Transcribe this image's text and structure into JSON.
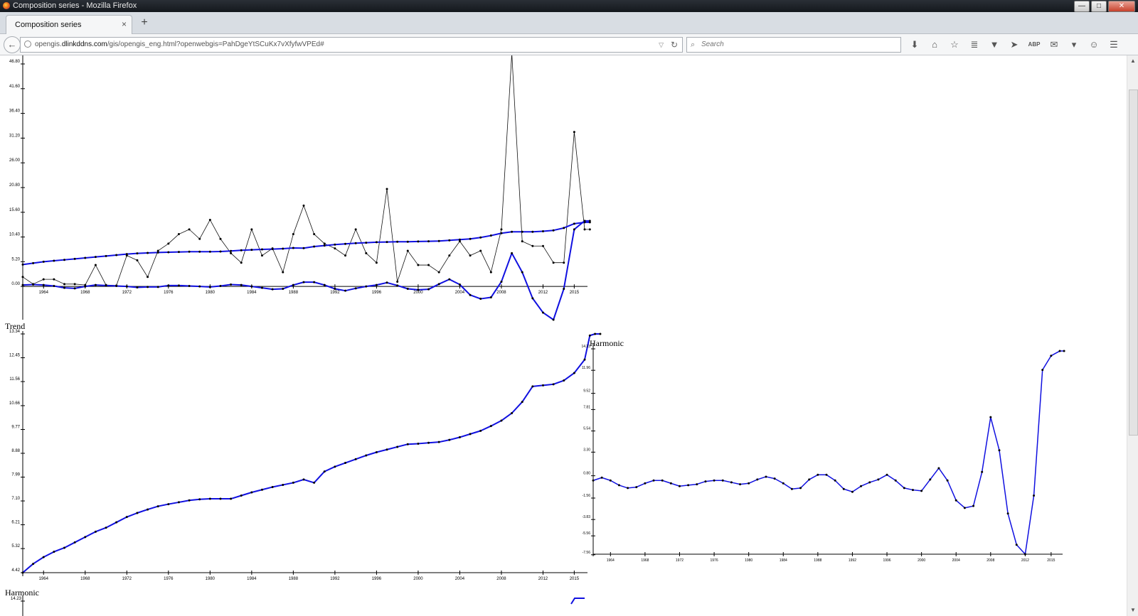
{
  "window": {
    "title": "Composition series - Mozilla Firefox",
    "controls": [
      "—",
      "□",
      "✕"
    ]
  },
  "tab": {
    "label": "Composition series",
    "close": "×",
    "new_tab": "+"
  },
  "navbar": {
    "back": "←",
    "url_prefix": "opengis.",
    "url_domain": "dlinkddns.com",
    "url_suffix": "/gis/opengis_eng.html?openwebgis=PahDgeYtSCuKx7vXfyfwVPEd#",
    "search_placeholder": "Search",
    "dropdown": "▽",
    "reload": "↻",
    "search_icon": "⌕",
    "toolbar_icons": [
      "⬇",
      "⌂",
      "☆",
      "≣",
      "▼",
      "➤",
      "ABP",
      "✉",
      "▾",
      "☺",
      "☰"
    ]
  },
  "scrollbar": {
    "up": "▲",
    "down": "▼"
  },
  "colors": {
    "blue": "#1010e0",
    "black": "#111111"
  },
  "charts": [
    {
      "id": "composition",
      "title": "",
      "chart_data": {
        "type": "line",
        "x": [
          1962,
          1963,
          1964,
          1965,
          1966,
          1967,
          1968,
          1969,
          1970,
          1971,
          1972,
          1973,
          1974,
          1975,
          1976,
          1977,
          1978,
          1979,
          1980,
          1981,
          1982,
          1983,
          1984,
          1985,
          1986,
          1987,
          1988,
          1989,
          1990,
          1991,
          1992,
          1993,
          1994,
          1995,
          1996,
          1997,
          1998,
          1999,
          2000,
          2001,
          2002,
          2003,
          2004,
          2005,
          2006,
          2007,
          2008,
          2009,
          2010,
          2011,
          2012,
          2013,
          2014,
          2015,
          2016
        ],
        "ylim": [
          -7.0,
          46.8
        ],
        "yticks": [
          "0.00",
          "5.20",
          "10.40",
          "15.60",
          "20.80",
          "26.00",
          "31.20",
          "36.40",
          "41.60",
          "46.80"
        ],
        "xticks": [
          "1964",
          "1968",
          "1972",
          "1976",
          "1980",
          "1984",
          "1988",
          "1992",
          "1996",
          "2000",
          "2004",
          "2008",
          "2012",
          "2015"
        ],
        "series": [
          {
            "name": "",
            "color": "#111111",
            "width": 0.8,
            "values": [
              2.0,
              0.5,
              1.5,
              1.5,
              0.5,
              0.5,
              0.3,
              4.5,
              0.3,
              0.2,
              6.5,
              5.5,
              2.0,
              7.5,
              9.0,
              11.0,
              12.0,
              10.0,
              14.0,
              10.0,
              7.0,
              5.0,
              12.0,
              6.5,
              8.0,
              3.0,
              11.0,
              17.0,
              11.0,
              9.0,
              8.0,
              6.5,
              12.0,
              7.0,
              5.0,
              20.5,
              1.0,
              7.5,
              4.5,
              4.5,
              3.0,
              6.5,
              9.5,
              6.5,
              7.5,
              3.0,
              12.0,
              49.0,
              9.5,
              8.5,
              8.5,
              5.0,
              5.0,
              32.5,
              12.0,
              12.0
            ]
          },
          {
            "name": "",
            "color": "#1010e0",
            "width": 2,
            "values": [
              4.6,
              4.9,
              5.2,
              5.4,
              5.6,
              5.8,
              6.0,
              6.2,
              6.4,
              6.6,
              6.8,
              6.95,
              7.05,
              7.15,
              7.2,
              7.25,
              7.3,
              7.3,
              7.3,
              7.35,
              7.45,
              7.6,
              7.7,
              7.8,
              7.85,
              7.95,
              8.1,
              8.05,
              8.4,
              8.6,
              8.8,
              8.95,
              9.1,
              9.2,
              9.3,
              9.35,
              9.4,
              9.4,
              9.45,
              9.5,
              9.55,
              9.7,
              9.85,
              10.0,
              10.3,
              10.7,
              11.2,
              11.5,
              11.5,
              11.5,
              11.6,
              11.8,
              12.3,
              13.2,
              13.5,
              13.5
            ]
          },
          {
            "name": "",
            "color": "#1010e0",
            "width": 2,
            "values": [
              0.3,
              0.4,
              0.3,
              0.1,
              -0.3,
              -0.4,
              0.0,
              0.3,
              0.2,
              0.1,
              0.0,
              -0.2,
              -0.1,
              -0.1,
              0.2,
              0.2,
              0.1,
              0.0,
              -0.1,
              0.1,
              0.4,
              0.3,
              0.0,
              -0.3,
              -0.6,
              -0.5,
              0.3,
              0.9,
              0.9,
              0.3,
              -0.5,
              -0.9,
              -0.4,
              0.0,
              0.3,
              0.8,
              0.2,
              -0.5,
              -0.7,
              -0.6,
              0.5,
              1.5,
              0.4,
              -1.8,
              -2.6,
              -2.3,
              1.0,
              7.0,
              3.0,
              -2.5,
              -5.5,
              -7.0,
              -0.5,
              12.0,
              13.8,
              13.8
            ]
          }
        ]
      }
    },
    {
      "id": "trend",
      "title": "Trend",
      "chart_data": {
        "type": "line",
        "x": [
          1962,
          1963,
          1964,
          1965,
          1966,
          1967,
          1968,
          1969,
          1970,
          1971,
          1972,
          1973,
          1974,
          1975,
          1976,
          1977,
          1978,
          1979,
          1980,
          1981,
          1982,
          1983,
          1984,
          1985,
          1986,
          1987,
          1988,
          1989,
          1990,
          1991,
          1992,
          1993,
          1994,
          1995,
          1996,
          1997,
          1998,
          1999,
          2000,
          2001,
          2002,
          2003,
          2004,
          2005,
          2006,
          2007,
          2008,
          2009,
          2010,
          2011,
          2012,
          2013,
          2014,
          2015,
          2016
        ],
        "ylim": [
          4.42,
          13.34
        ],
        "yticks": [
          "4.42",
          "5.32",
          "6.21",
          "7.10",
          "7.99",
          "8.88",
          "9.77",
          "10.66",
          "11.56",
          "12.45",
          "13.34"
        ],
        "xticks": [
          "1964",
          "1968",
          "1972",
          "1976",
          "1980",
          "1984",
          "1988",
          "1992",
          "1996",
          "2000",
          "2004",
          "2008",
          "2012",
          "2015"
        ],
        "series": [
          {
            "name": "",
            "color": "#1010e0",
            "width": 2,
            "values": [
              4.42,
              4.75,
              5.0,
              5.2,
              5.35,
              5.55,
              5.75,
              5.95,
              6.1,
              6.3,
              6.5,
              6.65,
              6.78,
              6.9,
              6.98,
              7.05,
              7.12,
              7.16,
              7.18,
              7.18,
              7.18,
              7.3,
              7.42,
              7.52,
              7.62,
              7.7,
              7.78,
              7.9,
              7.78,
              8.2,
              8.38,
              8.52,
              8.66,
              8.8,
              8.92,
              9.02,
              9.12,
              9.22,
              9.24,
              9.27,
              9.3,
              9.38,
              9.48,
              9.6,
              9.72,
              9.9,
              10.1,
              10.38,
              10.8,
              11.38,
              11.42,
              11.46,
              11.6,
              11.88,
              12.38,
              13.28,
              13.34,
              13.34
            ]
          }
        ]
      }
    },
    {
      "id": "harmonic-right",
      "title": "Harmonic",
      "chart_data": {
        "type": "line",
        "x": [
          1962,
          1963,
          1964,
          1965,
          1966,
          1967,
          1968,
          1969,
          1970,
          1971,
          1972,
          1973,
          1974,
          1975,
          1976,
          1977,
          1978,
          1979,
          1980,
          1981,
          1982,
          1983,
          1984,
          1985,
          1986,
          1987,
          1988,
          1989,
          1990,
          1991,
          1992,
          1993,
          1994,
          1995,
          1996,
          1997,
          1998,
          1999,
          2000,
          2001,
          2002,
          2003,
          2004,
          2005,
          2006,
          2007,
          2008,
          2009,
          2010,
          2011,
          2012,
          2013,
          2014,
          2015,
          2016
        ],
        "ylim": [
          -7.5,
          14.23
        ],
        "yticks": [
          "-7.56",
          "-5.56",
          "-3.83",
          "-1.56",
          "0.80",
          "3.30",
          "5.54",
          "7.81",
          "9.52",
          "11.96",
          "14.23"
        ],
        "xticks": [
          "1964",
          "1968",
          "1972",
          "1976",
          "1980",
          "1984",
          "1988",
          "1992",
          "1996",
          "2000",
          "2004",
          "2008",
          "2012",
          "2015"
        ],
        "series": [
          {
            "name": "",
            "color": "#1010e0",
            "width": 1.5,
            "values": [
              0.3,
              0.6,
              0.3,
              -0.2,
              -0.5,
              -0.4,
              0.0,
              0.3,
              0.3,
              0.0,
              -0.3,
              -0.2,
              -0.1,
              0.2,
              0.3,
              0.3,
              0.1,
              -0.1,
              0.0,
              0.4,
              0.7,
              0.5,
              0.0,
              -0.6,
              -0.5,
              0.4,
              0.9,
              0.9,
              0.3,
              -0.6,
              -0.9,
              -0.3,
              0.1,
              0.4,
              0.9,
              0.3,
              -0.5,
              -0.7,
              -0.8,
              0.4,
              1.6,
              0.3,
              -1.8,
              -2.6,
              -2.4,
              1.2,
              7.0,
              3.5,
              -3.2,
              -6.5,
              -7.5,
              -1.3,
              12.0,
              13.5,
              14.0,
              14.0
            ]
          }
        ]
      }
    },
    {
      "id": "harmonic-bottom",
      "title": "Harmonic",
      "chart_data": {
        "type": "line",
        "ylim": [
          0,
          14.23
        ],
        "yticks": [
          "14.23"
        ],
        "series": []
      }
    }
  ]
}
